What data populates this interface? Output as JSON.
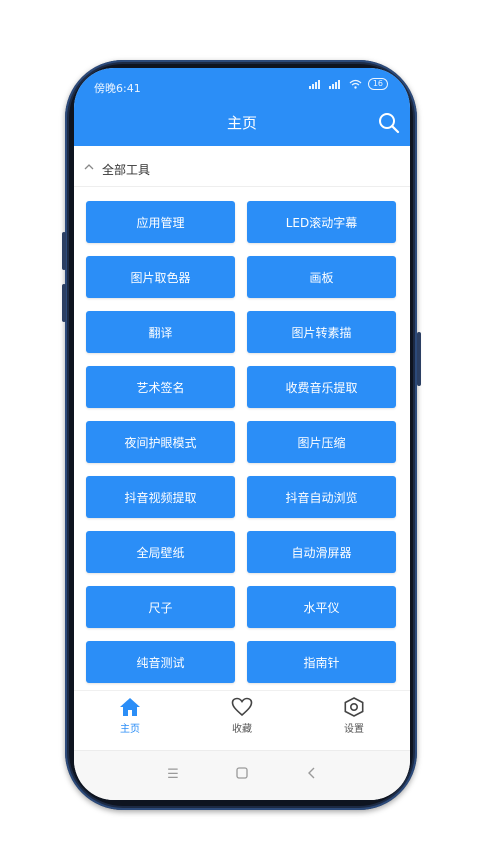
{
  "status_bar": {
    "time": "傍晚6:41",
    "battery": "16"
  },
  "header": {
    "title": "主页"
  },
  "section": {
    "label": "全部工具"
  },
  "tools": [
    "应用管理",
    "LED滚动字幕",
    "图片取色器",
    "画板",
    "翻译",
    "图片转素描",
    "艺术签名",
    "收费音乐提取",
    "夜间护眼模式",
    "图片压缩",
    "抖音视频提取",
    "抖音自动浏览",
    "全局壁纸",
    "自动滑屏器",
    "尺子",
    "水平仪",
    "纯音测试",
    "指南针"
  ],
  "tabbar": {
    "home": "主页",
    "favorites": "收藏",
    "settings": "设置"
  },
  "colors": {
    "accent": "#2b8ef7",
    "inactive": "#555555"
  },
  "icons": {
    "home": "home-icon",
    "favorites": "heart-icon",
    "settings": "gear-icon",
    "search": "search-icon",
    "collapse": "chevron-up-icon"
  }
}
